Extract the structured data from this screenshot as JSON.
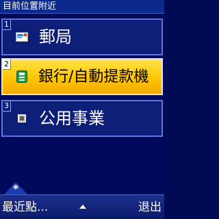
{
  "header": {
    "title": "目前位置附近"
  },
  "menu": {
    "items": [
      {
        "number": "1",
        "label": "郵局",
        "icon": "mail-icon",
        "selected": false
      },
      {
        "number": "2",
        "label": "銀行/自動提款機",
        "icon": "bank-icon",
        "selected": true
      },
      {
        "number": "3",
        "label": "公用事業",
        "icon": "utility-icon",
        "selected": false
      }
    ]
  },
  "footer": {
    "left_softkey": "最近點...",
    "right_softkey": "退出",
    "star_key": "*"
  },
  "colors": {
    "background": "#000a52",
    "selected_highlight": "#ffc600",
    "item_border": "#5a76e0"
  }
}
